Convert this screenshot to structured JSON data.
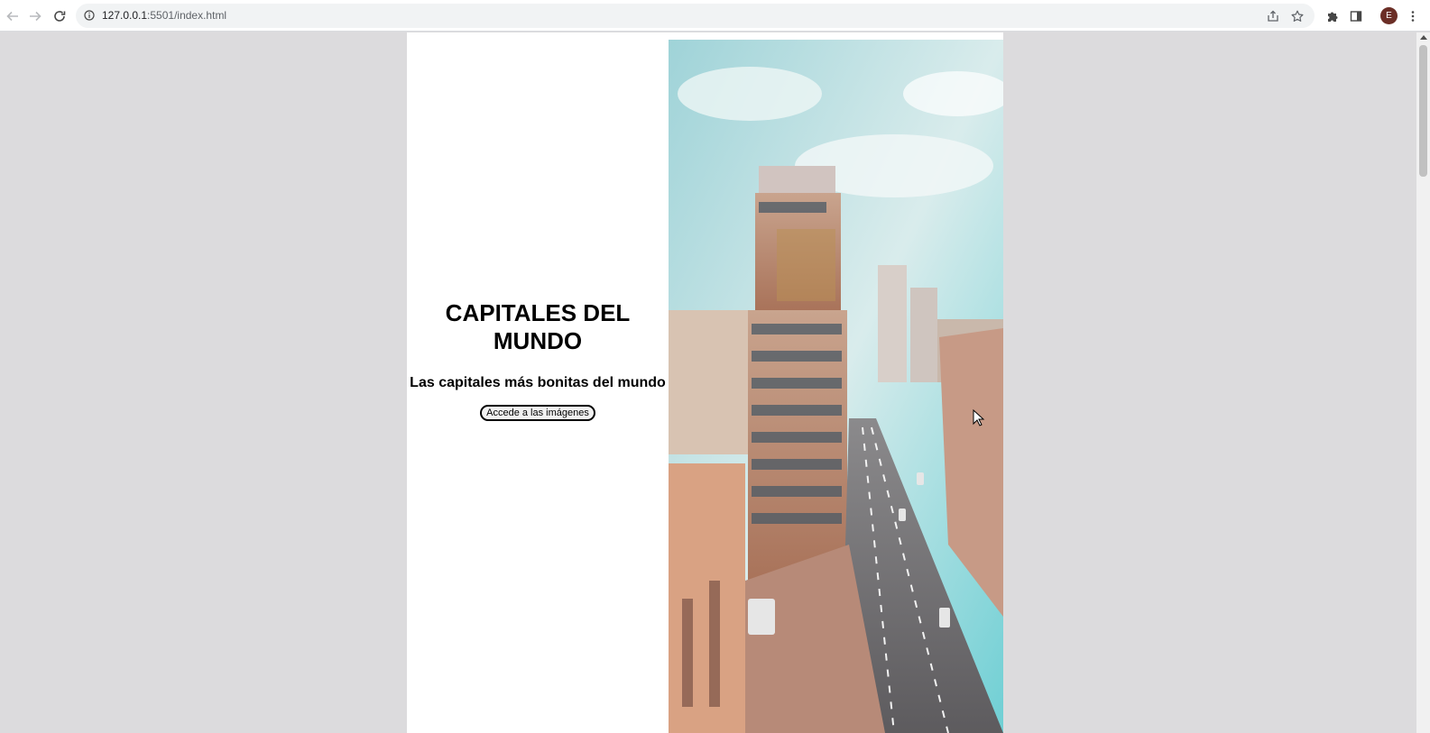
{
  "browser": {
    "url_host": "127.0.0.1",
    "url_path": ":5501/index.html",
    "profile_initial": "E",
    "icons": {
      "back": "arrow-left-icon",
      "forward": "arrow-right-icon",
      "reload": "reload-icon",
      "info": "info-icon",
      "share": "share-icon",
      "bookmark": "star-icon",
      "extensions": "puzzle-icon",
      "side_panel": "side-panel-icon",
      "menu": "kebab-menu-icon"
    }
  },
  "hero": {
    "title": "CAPITALES DEL MUNDO",
    "subtitle": "Las capitales más bonitas del mundo",
    "button_label": "Accede a las imágenes"
  },
  "colors": {
    "page_background": "#dcdbdd",
    "content_background": "#ffffff",
    "avatar": "#6b2e26"
  }
}
